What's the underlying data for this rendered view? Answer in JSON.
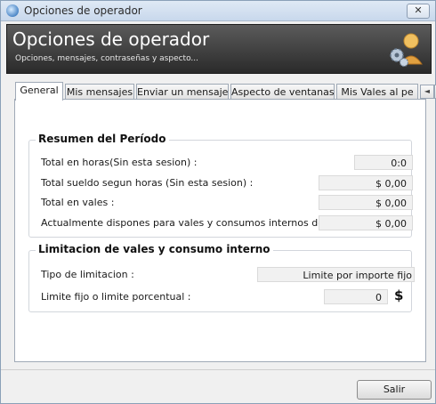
{
  "window": {
    "title": "Opciones de operador",
    "close_glyph": "✕"
  },
  "header": {
    "title": "Opciones de operador",
    "subtitle": "Opciones, mensajes, contraseñas y aspecto..."
  },
  "tabs": [
    {
      "label": "General"
    },
    {
      "label": "Mis mensajes"
    },
    {
      "label": "Enviar un mensaje"
    },
    {
      "label": "Aspecto de ventanas"
    },
    {
      "label": "Mis Vales al pe"
    }
  ],
  "tab_arrows": {
    "left": "◄",
    "right": "►"
  },
  "resumen": {
    "title": "Resumen del Período",
    "rows": [
      {
        "label": "Total en horas(Sin esta sesion) :",
        "value": "0:0"
      },
      {
        "label": "Total sueldo segun horas (Sin esta sesion) :",
        "value": "$ 0,00"
      },
      {
        "label": "Total en vales :",
        "value": "$ 0,00"
      },
      {
        "label": "Actualmente dispones para vales y consumos internos de:",
        "value": "$ 0,00"
      }
    ]
  },
  "limitacion": {
    "title": "Limitacion de vales y consumo interno",
    "tipo_label": "Tipo de limitacion :",
    "tipo_value": "Limite por importe fijo",
    "fijo_label": "Limite fijo o limite porcentual :",
    "fijo_value": "0",
    "currency_symbol": "$"
  },
  "footer": {
    "exit_label": "Salir"
  },
  "colors": {
    "header_bg": "#3a3a3a",
    "accent": "#4d87c7"
  },
  "icons": {
    "app": "operator-options-icon",
    "header": "gears-user-icon"
  }
}
